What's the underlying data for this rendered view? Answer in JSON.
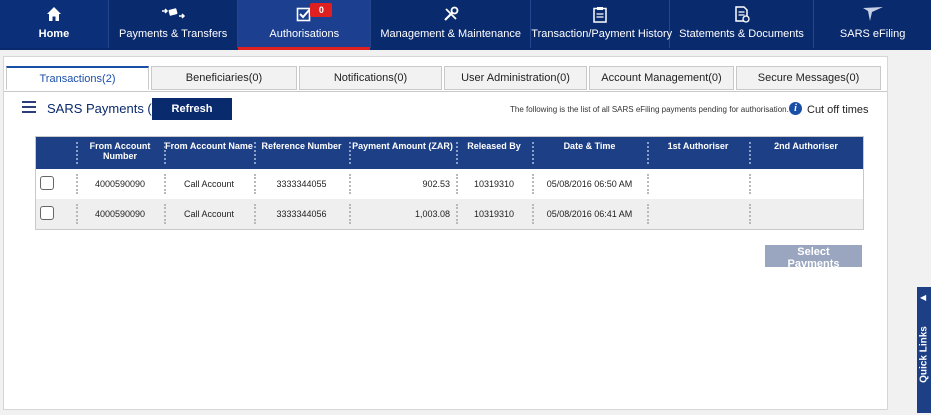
{
  "nav": {
    "items": [
      {
        "label": "Home",
        "icon": "home-icon"
      },
      {
        "label": "Payments & Transfers",
        "icon": "transfer-icon"
      },
      {
        "label": "Authorisations",
        "icon": "checkbox-icon",
        "badge": "0"
      },
      {
        "label": "Management & Maintenance",
        "icon": "tools-icon"
      },
      {
        "label": "Transaction/Payment History",
        "icon": "clipboard-icon"
      },
      {
        "label": "Statements & Documents",
        "icon": "document-icon"
      },
      {
        "label": "SARS eFiling",
        "icon": "sars-logo-icon"
      }
    ],
    "active": "Authorisations"
  },
  "tabs": [
    "Transactions(2)",
    "Beneficiaries(0)",
    "Notifications(0)",
    "User Administration(0)",
    "Account Management(0)",
    "Secure Messages(0)"
  ],
  "toolbar": {
    "title": "SARS Payments (2)",
    "refresh_label": "Refresh",
    "info_text": "The following is the list of all SARS eFiling payments pending for authorisation.",
    "cutoff_label": "Cut off times"
  },
  "table": {
    "headers": [
      "From Account Number",
      "From Account Name",
      "Reference Number",
      "Payment Amount (ZAR)",
      "Released By",
      "Date & Time",
      "1st Authoriser",
      "2nd Authoriser"
    ],
    "rows": [
      [
        "4000590090",
        "Call Account",
        "3333344055",
        "902.53",
        "10319310",
        "05/08/2016 06:50 AM",
        "",
        ""
      ],
      [
        "4000590090",
        "Call Account",
        "3333344056",
        "1,003.08",
        "10319310",
        "05/08/2016 06:41 AM",
        "",
        ""
      ]
    ]
  },
  "select_payments_label": "Select Payments",
  "quick_links_label": "Quick Links",
  "colors": {
    "navy": "#0a2a6e",
    "header_blue": "#1d3f85",
    "accent_red": "#e02020",
    "link_blue": "#1a4fa8"
  }
}
